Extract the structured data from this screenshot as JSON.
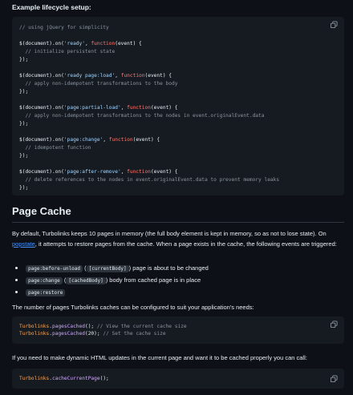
{
  "section_heading": "Example lifecycle setup:",
  "lifecycle_code": [
    {
      "parts": [
        {
          "t": "// using jQuery for simplicity",
          "c": "cm"
        }
      ]
    },
    {
      "parts": []
    },
    {
      "parts": [
        {
          "t": "$(document).on(",
          "c": ""
        },
        {
          "t": "'ready'",
          "c": "str"
        },
        {
          "t": ", ",
          "c": ""
        },
        {
          "t": "function",
          "c": "kw"
        },
        {
          "t": "(event) {",
          "c": ""
        }
      ]
    },
    {
      "parts": [
        {
          "t": "  // initialize persistent state",
          "c": "cm"
        }
      ]
    },
    {
      "parts": [
        {
          "t": "});",
          "c": ""
        }
      ]
    },
    {
      "parts": []
    },
    {
      "parts": [
        {
          "t": "$(document).on(",
          "c": ""
        },
        {
          "t": "'ready page:load'",
          "c": "str"
        },
        {
          "t": ", ",
          "c": ""
        },
        {
          "t": "function",
          "c": "kw"
        },
        {
          "t": "(event) {",
          "c": ""
        }
      ]
    },
    {
      "parts": [
        {
          "t": "  // apply non-idempotent transformations to the body",
          "c": "cm"
        }
      ]
    },
    {
      "parts": [
        {
          "t": "});",
          "c": ""
        }
      ]
    },
    {
      "parts": []
    },
    {
      "parts": [
        {
          "t": "$(document).on(",
          "c": ""
        },
        {
          "t": "'page:partial-load'",
          "c": "str"
        },
        {
          "t": ", ",
          "c": ""
        },
        {
          "t": "function",
          "c": "kw"
        },
        {
          "t": "(event) {",
          "c": ""
        }
      ]
    },
    {
      "parts": [
        {
          "t": "  // apply non-idempotent transformations to the nodes in event.originalEvent.data",
          "c": "cm"
        }
      ]
    },
    {
      "parts": [
        {
          "t": "});",
          "c": ""
        }
      ]
    },
    {
      "parts": []
    },
    {
      "parts": [
        {
          "t": "$(document).on(",
          "c": ""
        },
        {
          "t": "'page:change'",
          "c": "str"
        },
        {
          "t": ", ",
          "c": ""
        },
        {
          "t": "function",
          "c": "kw"
        },
        {
          "t": "(event) {",
          "c": ""
        }
      ]
    },
    {
      "parts": [
        {
          "t": "  // idempotent function",
          "c": "cm"
        }
      ]
    },
    {
      "parts": [
        {
          "t": "});",
          "c": ""
        }
      ]
    },
    {
      "parts": []
    },
    {
      "parts": [
        {
          "t": "$(document).on(",
          "c": ""
        },
        {
          "t": "'page:after-remove'",
          "c": "str"
        },
        {
          "t": ", ",
          "c": ""
        },
        {
          "t": "function",
          "c": "kw"
        },
        {
          "t": "(event) {",
          "c": ""
        }
      ]
    },
    {
      "parts": [
        {
          "t": "  // delete references to the nodes in event.originalEvent.data to prevent memory leaks",
          "c": "cm"
        }
      ]
    },
    {
      "parts": [
        {
          "t": "});",
          "c": ""
        }
      ]
    }
  ],
  "page_cache_heading": "Page Cache",
  "page_cache_para": {
    "before_link": "By default, Turbolinks keeps 10 pages in memory (the full body element is kept in memory, so as not to lose state). On ",
    "link": "popstate",
    "after_link": ", it attempts to restore pages from the cache. When a page exists in the cache, the following events are triggered:"
  },
  "events": [
    {
      "code": "page:before-unload",
      "paren_open": " (",
      "arg": "[currentBody]",
      "paren_close": ") ",
      "text": "page is about to be changed"
    },
    {
      "code": "page:change",
      "paren_open": " (",
      "arg": "[cachedBody]",
      "paren_close": ") ",
      "text": "body from cached page is in place"
    },
    {
      "code": "page:restore",
      "paren_open": "",
      "arg": "",
      "paren_close": "",
      "text": ""
    }
  ],
  "cache_count_para": "The number of pages Turbolinks caches can be configured to suit your application's needs:",
  "cache_code": [
    {
      "parts": [
        {
          "t": "Turbolinks",
          "c": "obj"
        },
        {
          "t": ".",
          "c": ""
        },
        {
          "t": "pagesCached",
          "c": "fn"
        },
        {
          "t": "(); ",
          "c": ""
        },
        {
          "t": "// View the current cache size",
          "c": "cm"
        }
      ]
    },
    {
      "parts": [
        {
          "t": "Turbolinks",
          "c": "obj"
        },
        {
          "t": ".",
          "c": ""
        },
        {
          "t": "pagesCached",
          "c": "fn"
        },
        {
          "t": "(20); ",
          "c": ""
        },
        {
          "t": "// Set the cache size",
          "c": "cm"
        }
      ]
    }
  ],
  "dynamic_para": "If you need to make dynamic HTML updates in the current page and want it to be cached properly you can call:",
  "current_code": [
    {
      "parts": [
        {
          "t": "Turbolinks",
          "c": "obj"
        },
        {
          "t": ".",
          "c": ""
        },
        {
          "t": "cacheCurrentPage",
          "c": "fn"
        },
        {
          "t": "();",
          "c": ""
        }
      ]
    }
  ]
}
